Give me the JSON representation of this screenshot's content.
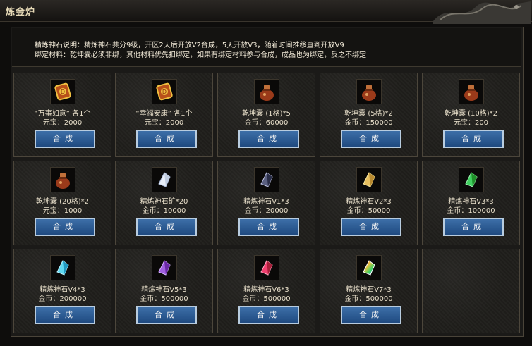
{
  "window": {
    "title": "炼金炉"
  },
  "description": {
    "line1": "精炼神石说明：精炼神石共分9级，开区2天后开放V2合成，5天开放V3，随着时间推移直到开放V9",
    "line2": "绑定材料：乾坤囊必须非绑，其他材料优先扣绑定，如果有绑定材料参与合成，成品也为绑定，反之不绑定"
  },
  "button_label": "合成",
  "items": [
    {
      "name": "“万事如意” 各1个",
      "cost": "元宝：2000",
      "icon": "red-gold-token-icon"
    },
    {
      "name": "“幸福安康” 各1个",
      "cost": "元宝：2000",
      "icon": "red-gold-token-icon"
    },
    {
      "name": "乾坤囊 (1格)*5",
      "cost": "金币：60000",
      "icon": "pouch-icon"
    },
    {
      "name": "乾坤囊 (5格)*2",
      "cost": "金币：150000",
      "icon": "pouch-icon"
    },
    {
      "name": "乾坤囊 (10格)*2",
      "cost": "元宝：200",
      "icon": "pouch-icon"
    },
    {
      "name": "乾坤囊 (20格)*2",
      "cost": "元宝：1000",
      "icon": "pouch-icon"
    },
    {
      "name": "精炼神石矿*20",
      "cost": "金币：10000",
      "icon": "white-crystal-icon"
    },
    {
      "name": "精炼神石V1*3",
      "cost": "金币：20000",
      "icon": "dark-crystal-icon"
    },
    {
      "name": "精炼神石V2*3",
      "cost": "金币：50000",
      "icon": "gold-crystal-icon"
    },
    {
      "name": "精炼神石V3*3",
      "cost": "金币：100000",
      "icon": "green-crystal-icon"
    },
    {
      "name": "精炼神石V4*3",
      "cost": "金币：200000",
      "icon": "cyan-crystal-icon"
    },
    {
      "name": "精炼神石V5*3",
      "cost": "金币：500000",
      "icon": "purple-crystal-icon"
    },
    {
      "name": "精炼神石V6*3",
      "cost": "金币：500000",
      "icon": "red-crystal-icon"
    },
    {
      "name": "精炼神石V7*3",
      "cost": "金币：500000",
      "icon": "rainbow-crystal-icon"
    }
  ],
  "colors": {
    "button": "#2c5b94",
    "panel": "#1b1a18",
    "border": "#4c463b",
    "text": "#e8dfca"
  }
}
